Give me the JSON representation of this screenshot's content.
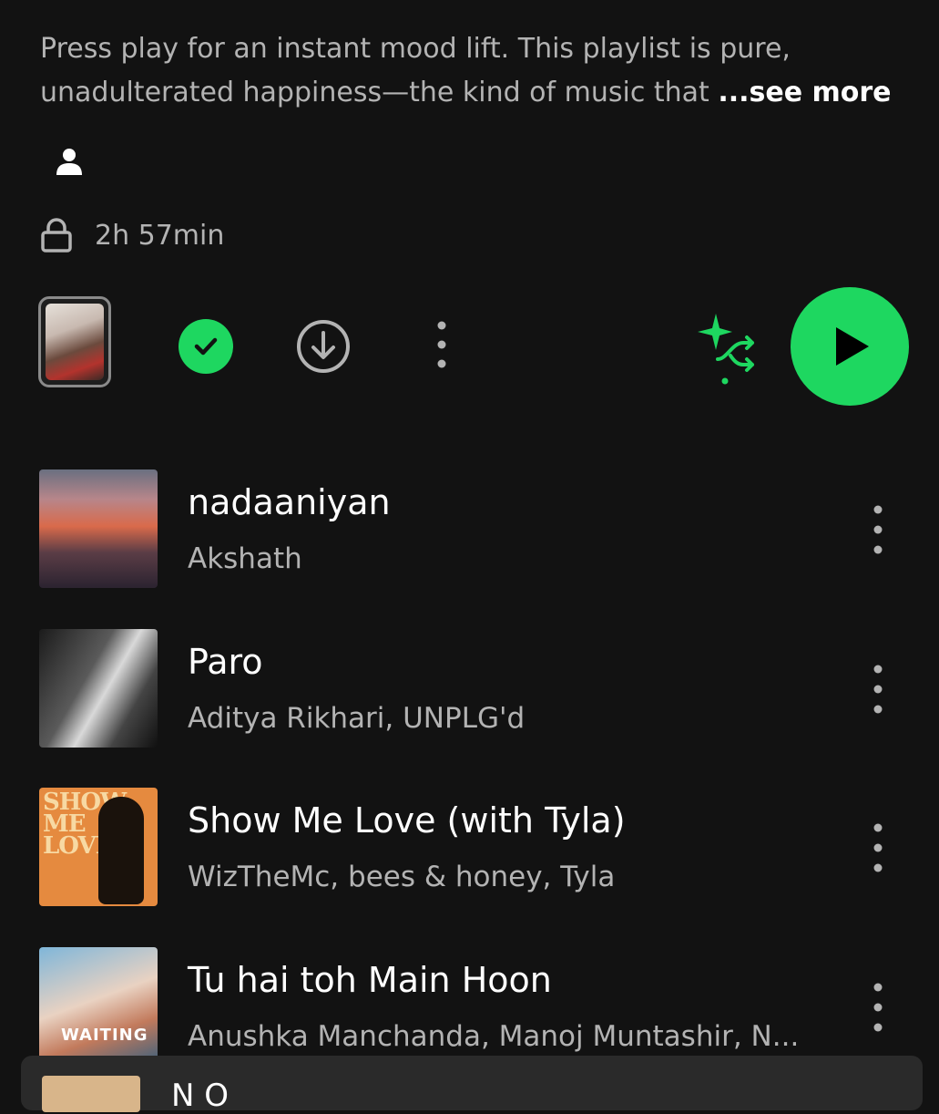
{
  "playlist": {
    "description": "Press play for an instant mood lift. This playlist is pure, unadulterated happiness—the kind of music that ",
    "see_more": "...see more",
    "duration": "2h 57min"
  },
  "controls": {
    "owner_icon": "person-icon",
    "lock_icon": "lock-icon",
    "saved_icon": "check-icon",
    "download_icon": "download-icon",
    "more_icon": "more-vertical-icon",
    "smart_shuffle_icon": "smart-shuffle-icon",
    "play_icon": "play-icon"
  },
  "tracks": [
    {
      "title": "nadaaniyan",
      "artist": "Akshath"
    },
    {
      "title": "Paro",
      "artist": "Aditya Rikhari, UNPLG'd"
    },
    {
      "title": "Show Me Love (with Tyla)",
      "artist": "WizTheMc, bees & honey, Tyla"
    },
    {
      "title": "Tu hai toh Main Hoon",
      "artist": "Anushka Manchanda, Manoj Muntashir, N..."
    }
  ],
  "album_art_text": {
    "show_me_love": "SHOW ME LOVE",
    "waiting": "WAITING"
  },
  "mini_player": {
    "title": "N  O"
  },
  "colors": {
    "background": "#121212",
    "accent": "#1ed760",
    "secondary_text": "#b3b3b3",
    "primary_text": "#ffffff"
  }
}
